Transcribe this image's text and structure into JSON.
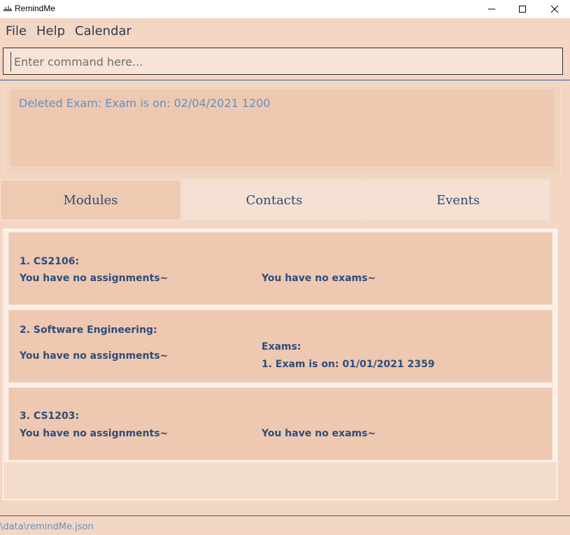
{
  "window": {
    "title": "RemindMe",
    "icons": {
      "app": "app-icon",
      "minimize": "minimize-icon",
      "maximize": "maximize-icon",
      "close": "close-icon"
    }
  },
  "menu": {
    "items": [
      "File",
      "Help",
      "Calendar"
    ]
  },
  "command": {
    "placeholder": "Enter command here..."
  },
  "result": {
    "message": "Deleted Exam: Exam is on: 02/04/2021 1200"
  },
  "tabs": [
    {
      "label": "Modules",
      "active": true
    },
    {
      "label": "Contacts",
      "active": false
    },
    {
      "label": "Events",
      "active": false
    }
  ],
  "modules": [
    {
      "title": "1. CS2106:",
      "assignments": "You have no assignments~",
      "exams_header": "",
      "exams": "You have no exams~"
    },
    {
      "title": "2. Software Engineering:",
      "assignments": "You have no assignments~",
      "exams_header": "Exams:",
      "exams": "1. Exam is on: 01/01/2021 2359"
    },
    {
      "title": "3. CS1203:",
      "assignments": "You have no assignments~",
      "exams_header": "",
      "exams": "You have no exams~"
    }
  ],
  "status": {
    "path": "\\data\\remindMe.json"
  },
  "colors": {
    "background": "#f3d7c4",
    "card": "#eec8b0",
    "text_dark": "#2d4d7a",
    "text_accent": "#5d93c5"
  }
}
